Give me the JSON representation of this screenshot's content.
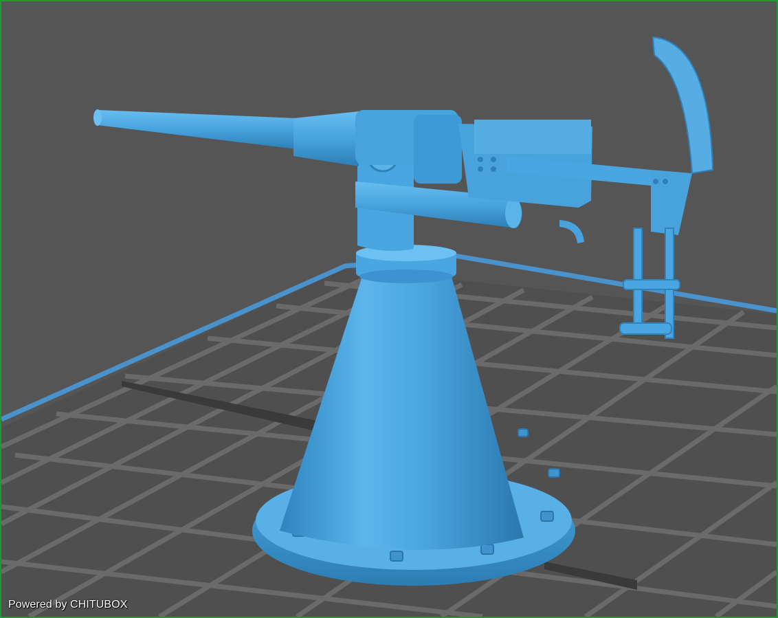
{
  "app": {
    "watermark_text": "Powered by CHITUBOX"
  },
  "colors": {
    "frame": "#1e9a2e",
    "background": "#555555",
    "grid_line": "#6d6d6d",
    "plate_edge": "#4a92cc",
    "model": "#48a3dd",
    "model_shadow": "#2c7fb8",
    "model_highlight": "#6cc0f2"
  },
  "scene": {
    "object": "naval-deck-gun-3d-model",
    "view": "perspective"
  }
}
